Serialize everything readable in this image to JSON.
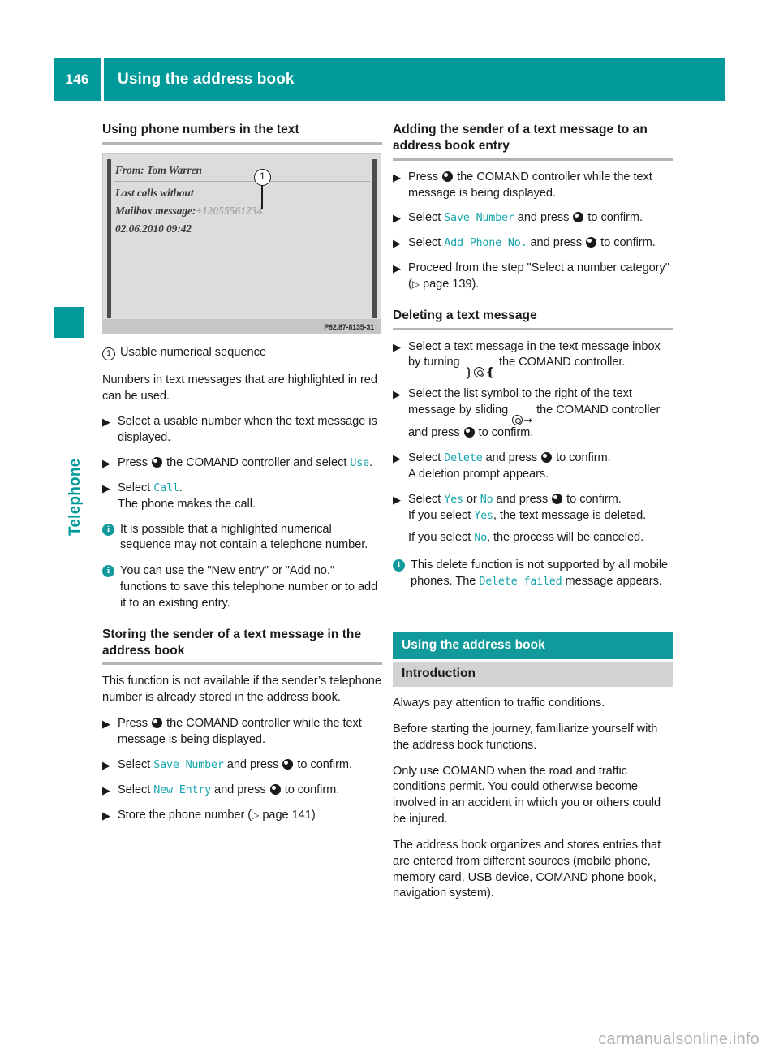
{
  "header": {
    "page_number": "146",
    "title": "Using the address book"
  },
  "side_tab": {
    "label": "Telephone"
  },
  "figure": {
    "line1": "From: Tom Warren",
    "line2": "Last calls without",
    "line3_label": "Mailbox message:",
    "line3_number": "+12055561234",
    "line4": "02.06.2010 09:42",
    "callout": "1",
    "code": "P82.87-8135-31"
  },
  "left_column": {
    "heading": "Using phone numbers in the text",
    "legend": {
      "num": "1",
      "text": "Usable numerical sequence"
    },
    "intro": "Numbers in text messages that are highlighted in red can be used.",
    "steps": [
      {
        "pre": "Select a usable number when the text message is displayed."
      },
      {
        "pre": "Press ",
        "mid": " the COMAND controller and select ",
        "ui": "Use",
        "post": "."
      },
      {
        "pre": "Select ",
        "ui": "Call",
        "post": ".",
        "sub": "The phone makes the call."
      }
    ],
    "notes": [
      "It is possible that a highlighted numerical sequence may not contain a telephone number.",
      "You can use the \"New entry\" or \"Add no.\" functions to save this telephone number or to add it to an existing entry."
    ],
    "heading2": "Storing the sender of a text message in the address book",
    "body2": "This function is not available if the sender’s telephone number is already stored in the address book.",
    "steps2": [
      {
        "pre": "Press ",
        "post": " the COMAND controller while the text message is being displayed."
      },
      {
        "pre": "Select ",
        "ui": "Save Number",
        "mid": " and press ",
        "post": " to confirm."
      },
      {
        "pre": "Select ",
        "ui": "New Entry",
        "mid": " and press ",
        "post": " to confirm."
      },
      {
        "pre": "Store the phone number (",
        "page_ref": "page 141",
        "post": ")"
      }
    ]
  },
  "right_column": {
    "heading": "Adding the sender of a text message to an address book entry",
    "steps": [
      {
        "pre": "Press ",
        "post": " the COMAND controller while the text message is being displayed."
      },
      {
        "pre": "Select ",
        "ui": "Save Number",
        "mid": " and press ",
        "post": " to confirm."
      },
      {
        "pre": "Select ",
        "ui": "Add Phone No.",
        "mid": " and press ",
        "post": " to confirm."
      },
      {
        "pre": "Proceed from the step \"Select a number category\" (",
        "page_ref": "page 139",
        "post": ")."
      }
    ],
    "heading2": "Deleting a text message",
    "steps2": [
      {
        "pre": "Select a text message in the text message inbox by turning ",
        "post": " the COMAND controller."
      },
      {
        "pre": "Select the list symbol to the right of the text message by sliding ",
        "mid": " the COMAND controller and press ",
        "post": " to confirm."
      },
      {
        "pre": "Select ",
        "ui": "Delete",
        "mid": " and press ",
        "post": " to confirm.",
        "sub": "A deletion prompt appears."
      },
      {
        "pre": "Select ",
        "ui1": "Yes",
        "mid1": " or ",
        "ui2": "No",
        "mid2": " and press ",
        "post": " to confirm.",
        "sub1_pre": "If you select ",
        "sub1_ui": "Yes",
        "sub1_post": ", the text message is deleted.",
        "sub2_pre": "If you select ",
        "sub2_ui": "No",
        "sub2_post": ", the process will be canceled."
      }
    ],
    "note": {
      "pre": "This delete function is not supported by all mobile phones. The ",
      "ui": "Delete failed",
      "post": " message appears."
    },
    "banner_teal": "Using the address book",
    "banner_gray": "Introduction",
    "paragraphs": [
      "Always pay attention to traffic conditions.",
      "Before starting the journey, familiarize yourself with the address book functions.",
      "Only use COMAND when the road and traffic conditions permit. You could otherwise become involved in an accident in which you or others could be injured.",
      "The address book organizes and stores entries that are entered from different sources (mobile phone, memory card, USB device, COMAND phone book, navigation system)."
    ]
  },
  "footer": {
    "watermark": "carmanualsonline.info"
  },
  "colors": {
    "teal": "#009a9a",
    "teal_ui": "#17a5ac",
    "gray_banner": "#d2d2d2"
  }
}
